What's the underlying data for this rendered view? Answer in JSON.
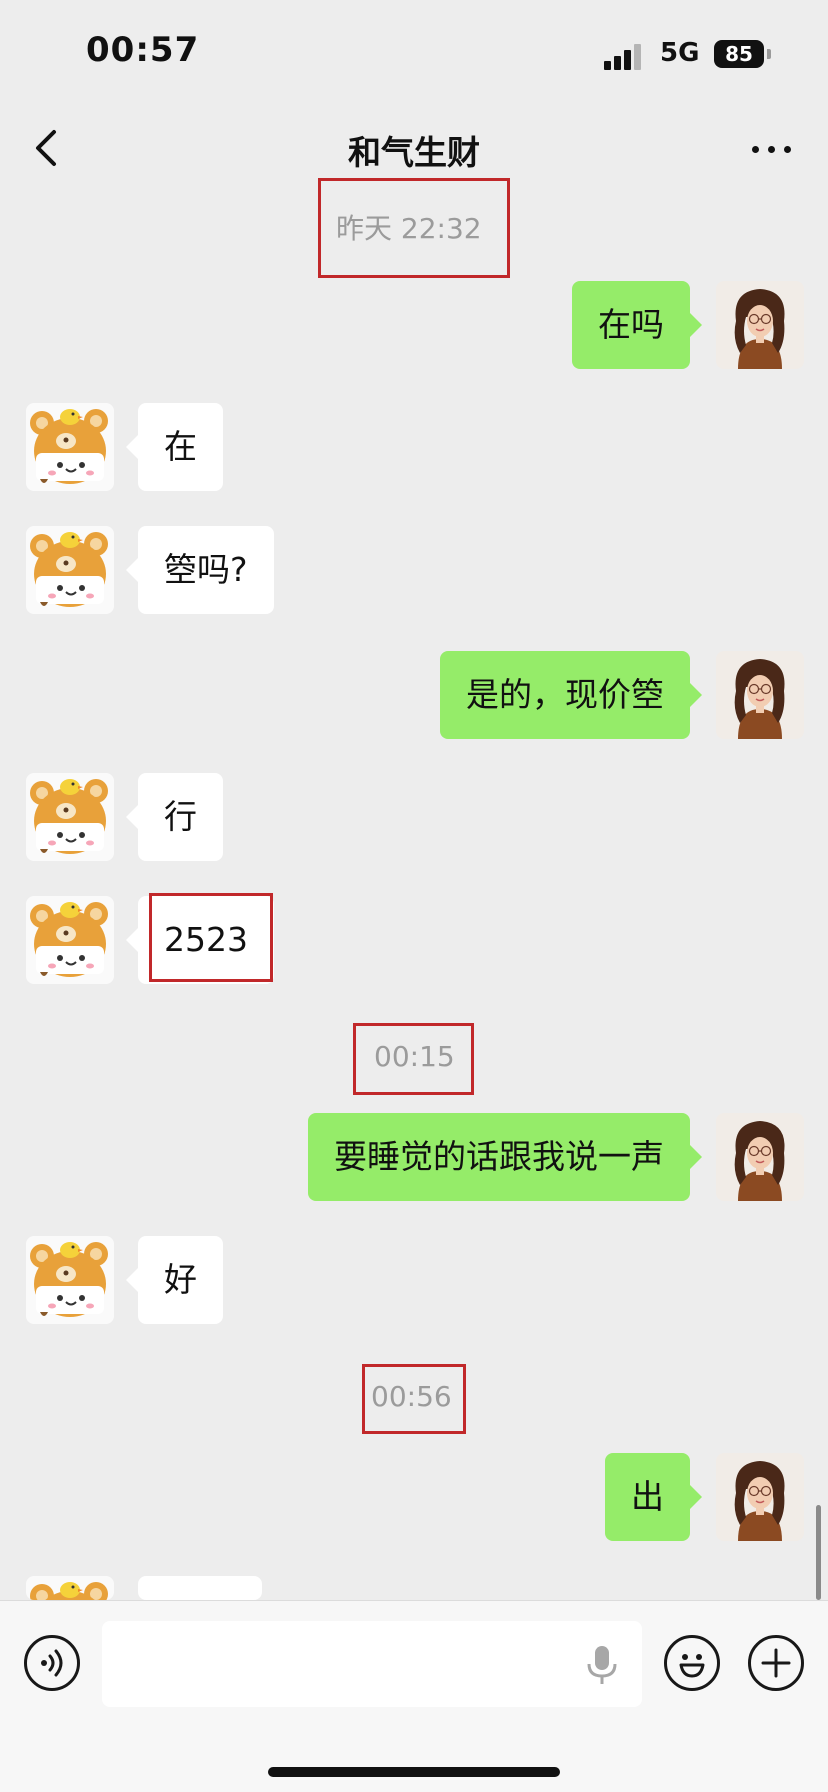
{
  "status_bar": {
    "time": "00:57",
    "network": "5G",
    "battery": "85"
  },
  "nav": {
    "title": "和气生财",
    "back_icon": "chevron-left-icon",
    "more_icon": "more-dots-icon"
  },
  "messages": {
    "ts1": "昨天 22:32",
    "m1": "在吗",
    "m2": "在",
    "m3": "箜吗?",
    "m4": "是的，现价箜",
    "m5": "行",
    "m6": "2523",
    "ts2": "00:15",
    "m7": "要睡觉的话跟我说一声",
    "m8": "好",
    "ts3": "00:56",
    "m9": "出"
  },
  "input_bar": {
    "voice_icon": "voice-icon",
    "mic_icon": "mic-icon",
    "emoji_icon": "emoji-icon",
    "plus_icon": "plus-icon",
    "placeholder": ""
  },
  "colors": {
    "background": "#ededed",
    "outgoing_bubble": "#95ec69",
    "incoming_bubble": "#ffffff",
    "highlight_box": "#c1282a",
    "timestamp": "#9b9b9b"
  }
}
